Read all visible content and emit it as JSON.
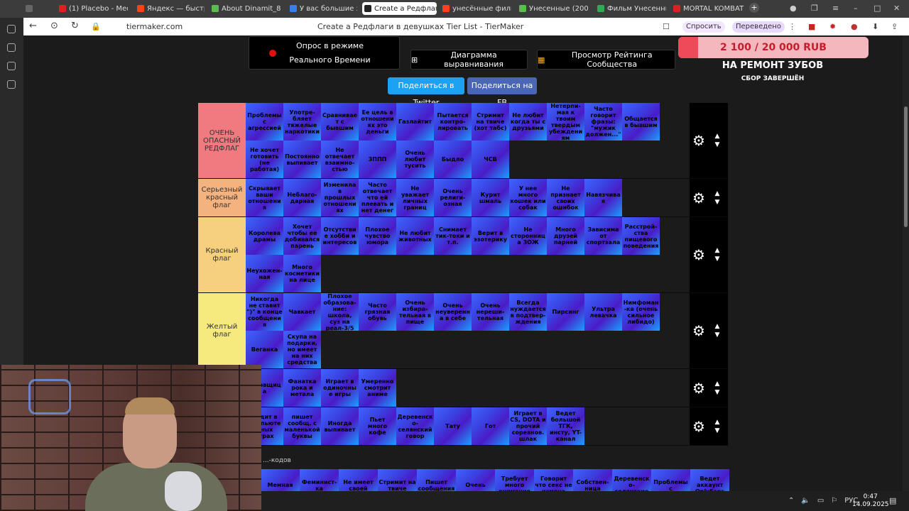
{
  "browser": {
    "tabs": [
      {
        "label": "",
        "icon_color": "#666"
      },
      {
        "label": "(1) Placebo - Meds",
        "icon_color": "#e02020"
      },
      {
        "label": "Яндекс — быстрый",
        "icon_color": "#fc3f1d"
      },
      {
        "label": "About Dinamit_8 -",
        "icon_color": "#58c04a"
      },
      {
        "label": "У вас большие запр",
        "icon_color": "#3b7ded"
      },
      {
        "label": "Create a Редфлаг",
        "icon_color": "#222"
      },
      {
        "label": "унесённые фильм",
        "icon_color": "#fc3f1d"
      },
      {
        "label": "Унесенные (2002)",
        "icon_color": "#58c04a"
      },
      {
        "label": "Фильм Унесенные",
        "icon_color": "#34a853"
      },
      {
        "label": "MORTAL KOMBAT",
        "icon_color": "#e02020"
      }
    ],
    "url": "tiermaker.com",
    "page_title": "Create a Редфлаги в девушках Tier List - TierMaker",
    "ask_label": "Спросить",
    "translated_label": "Переведено"
  },
  "top": {
    "realtime_label": "Опрос в режиме Реального Времени",
    "alignment_label": "Диаграмма выравнивания",
    "community_label": "Просмотр Рейтинга Сообщества",
    "share_twitter": "Поделиться в Twitter",
    "share_fb": "Поделиться на FB"
  },
  "donation": {
    "amount": "2 100 / 20 000 RUB",
    "progress": 0.105,
    "title": "НА РЕМОНТ ЗУБОВ",
    "subtitle": "СБОР ЗАВЕРШЁН"
  },
  "tiers": [
    {
      "label": "ОЧЕНЬ ОПАСНЫЙ РЕДФЛАГ",
      "color": "#f07a7f",
      "items": [
        "Проблемы с агрессией",
        "Употре-бляет тяжелые наркотики",
        "Сравнивает с бывшим",
        "Ее цель в отношениях это деньги",
        "Газлайтит",
        "Пытается контро-лировать",
        "Стримит на твиче (хот табс)",
        "Не любит когда ты с друзьями",
        "Нетерпи-мая к твоим твердым убеждениям",
        "Часто говорит фразы: \"мужик должен...\"",
        "Общается в бывшим",
        "Не хочет готовить (не работая)",
        "Постоянно выпивает",
        "Не отвечает взаимно-стью",
        "ЗППП",
        "Очень любит тусить",
        "Быдло",
        "ЧСВ"
      ]
    },
    {
      "label": "Серьезный красный флаг",
      "color": "#f4b27f",
      "items": [
        "Скрывает ваши отношения",
        "Неблаго-дарная",
        "Изменила в прошлых отношениях",
        "Часто отвечает что ей плевать и нет денег",
        "Не уважает личных границ",
        "Очень религи-озная",
        "Курит шмаль",
        "У нее много кошек или собак",
        "Не признает своих ошибок",
        "Навязчивая"
      ]
    },
    {
      "label": "Красный флаг",
      "color": "#f6d07f",
      "items": [
        "Королева драмы",
        "Хочет чтобы ее добивался парень",
        "Отсутствие хобби и интересов",
        "Плохое чувство юмора",
        "Не любит животных",
        "Снимает тик-токи и т.п.",
        "Верит в эзотерику",
        "Не сторонница ЗОЖ",
        "Много друзей парней",
        "Зависима от спортзала",
        "Расстрой-ства пищевого поведения",
        "Неухожен-ная",
        "Много косметики на лице"
      ]
    },
    {
      "label": "Желтый флаг",
      "color": "#f6ea7f",
      "items": [
        "Никогда не ставит \")\" в конце сообщения",
        "Чавкает",
        "Плохое образова-ние: школа, суз на реал-3/5",
        "Часто грязная обувь",
        "Очень избира-тельная в пище",
        "Очень неуверенна в себе",
        "Очень нереши-тельная",
        "Всегда нуждается в подтвер-ждения",
        "Пирсинг",
        "Ультра левачка",
        "Нимфоман-ка (очень сильное либидо)",
        "Веганка",
        "Скупа на подарки, но имеет на них средства"
      ]
    },
    {
      "label": "",
      "color": "#d9ef7f",
      "items": [
        "Тусовщица",
        "Фанатка рока и метала",
        "Играет в одиночные игры",
        "Умеренно смотрит аниме"
      ]
    },
    {
      "label": "",
      "color": "#bfef7f",
      "items": [
        "Сидит в компьютерных играх",
        "пишет сообщ. с маленькой буквы",
        "Иногда выпивает",
        "Пьет много кофе",
        "Деревенско-селянский говор",
        "Тату",
        "Гот",
        "Играет в CS, DOTA и прочий соревнов. шлак",
        "Ведет большой ТГК, инсту, YT-канал"
      ]
    }
  ],
  "bottom": {
    "label": "...-кодов",
    "items": [
      "Мемная",
      "Феминист-ка",
      "Не имеет своей",
      "Стримит на твиче",
      "Пишет сообщения",
      "Очень",
      "Требует много внимания",
      "Говорит что секс не измена",
      "Собствен-ница",
      "Деревенско-селянские",
      "Проблемы с",
      "Ведет аккаунт OnlyFans",
      "Пытается быть главой"
    ]
  },
  "taskbar": {
    "lang": "РУС",
    "time": "0:47",
    "date": "14.09.2025"
  }
}
